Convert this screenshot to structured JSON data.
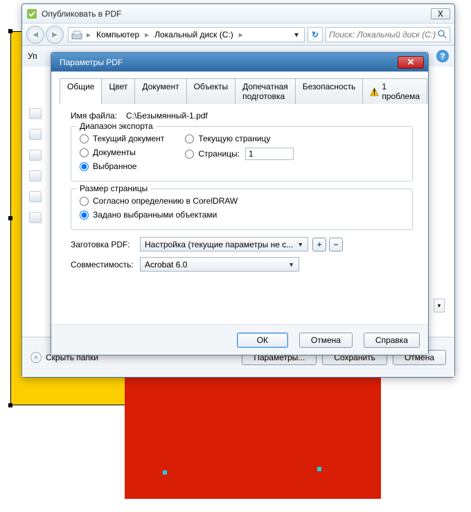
{
  "publish": {
    "title": "Опубликовать в PDF",
    "breadcrumb": {
      "item1": "Компьютер",
      "item2": "Локальный диск (C:)"
    },
    "search_placeholder": "Поиск: Локальный диск (C:)",
    "body_label": "Уп",
    "hide_folders": "Скрыть папки",
    "btn_params": "Параметры...",
    "btn_save": "Сохранить",
    "btn_cancel": "Отмена"
  },
  "params": {
    "title": "Параметры PDF",
    "tabs": {
      "general": "Общие",
      "color": "Цвет",
      "document": "Документ",
      "objects": "Объекты",
      "prepress": "Допечатная подготовка",
      "security": "Безопасность",
      "issues": "1 проблема"
    },
    "filename_label": "Имя файла:",
    "filename_value": "C:\\Безымянный-1.pdf",
    "export_range": {
      "title": "Диапазон экспорта",
      "current_doc": "Текущий документ",
      "documents": "Документы",
      "selected": "Выбранное",
      "current_page": "Текущую страницу",
      "pages": "Страницы:",
      "pages_value": "1"
    },
    "page_size": {
      "title": "Размер страницы",
      "coreldraw": "Согласно определению в CorelDRAW",
      "selected_objects": "Задано выбранными объектами"
    },
    "preset_label": "Заготовка PDF:",
    "preset_value": "Настройка (текущие параметры не с...",
    "compat_label": "Совместимость:",
    "compat_value": "Acrobat 6.0",
    "btn_ok": "ОК",
    "btn_cancel": "Отмена",
    "btn_help": "Справка"
  }
}
